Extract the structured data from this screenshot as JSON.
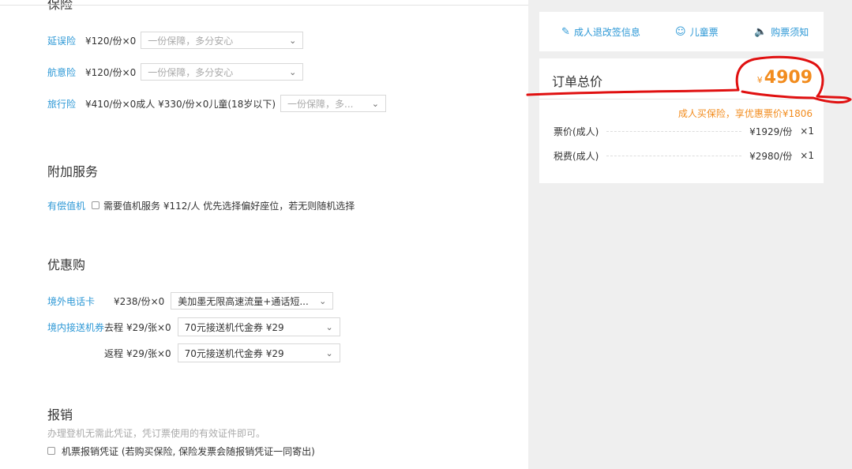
{
  "insurance": {
    "title": "保险",
    "delay": {
      "label": "延误险",
      "price": "¥120/份×0",
      "placeholder": "一份保障，多分安心"
    },
    "accident": {
      "label": "航意险",
      "price": "¥120/份×0",
      "placeholder": "一份保障，多分安心"
    },
    "travel": {
      "label": "旅行险",
      "price": "¥410/份×0成人  ¥330/份×0儿童(18岁以下)",
      "placeholder": "一份保障，多..."
    }
  },
  "extra": {
    "title": "附加服务",
    "checkin": {
      "label": "有偿值机",
      "text": "需要值机服务 ¥112/人 优先选择偏好座位，若无则随机选择"
    }
  },
  "discount": {
    "title": "优惠购",
    "sim": {
      "label": "境外电话卡",
      "price": "¥238/份×0",
      "value": "美加墨无限高速流量+通话短..."
    },
    "transfer": {
      "label": "境内接送机券",
      "outbound": {
        "label": "去程",
        "price": "¥29/张×0",
        "value": "70元接送机代金券   ¥29"
      },
      "return": {
        "label": "返程",
        "price": "¥29/张×0",
        "value": "70元接送机代金券   ¥29"
      }
    }
  },
  "reimburse": {
    "title": "报销",
    "hint": "办理登机无需此凭证，凭订票使用的有效证件即可。",
    "checkbox": "机票报销凭证 (若购买保险, 保险发票会随报销凭证一同寄出)"
  },
  "sidebar": {
    "tabs": [
      {
        "label": "成人退改签信息",
        "icon": "edit-icon"
      },
      {
        "label": "儿童票",
        "icon": "smile-icon"
      },
      {
        "label": "购票须知",
        "icon": "speaker-icon"
      }
    ],
    "total": {
      "label": "订单总价",
      "currency": "¥",
      "amount": "4909",
      "promo": "成人买保险，享优惠票价¥1806",
      "lines": [
        {
          "label": "票价(成人)",
          "amount": "¥1929/份",
          "qty": "×1"
        },
        {
          "label": "税费(成人)",
          "amount": "¥2980/份",
          "qty": "×1"
        }
      ]
    }
  },
  "colors": {
    "link": "#2d98d6",
    "accent": "#f28c1e",
    "annotation": "#e01010",
    "sidebar_bg": "#efefef"
  }
}
